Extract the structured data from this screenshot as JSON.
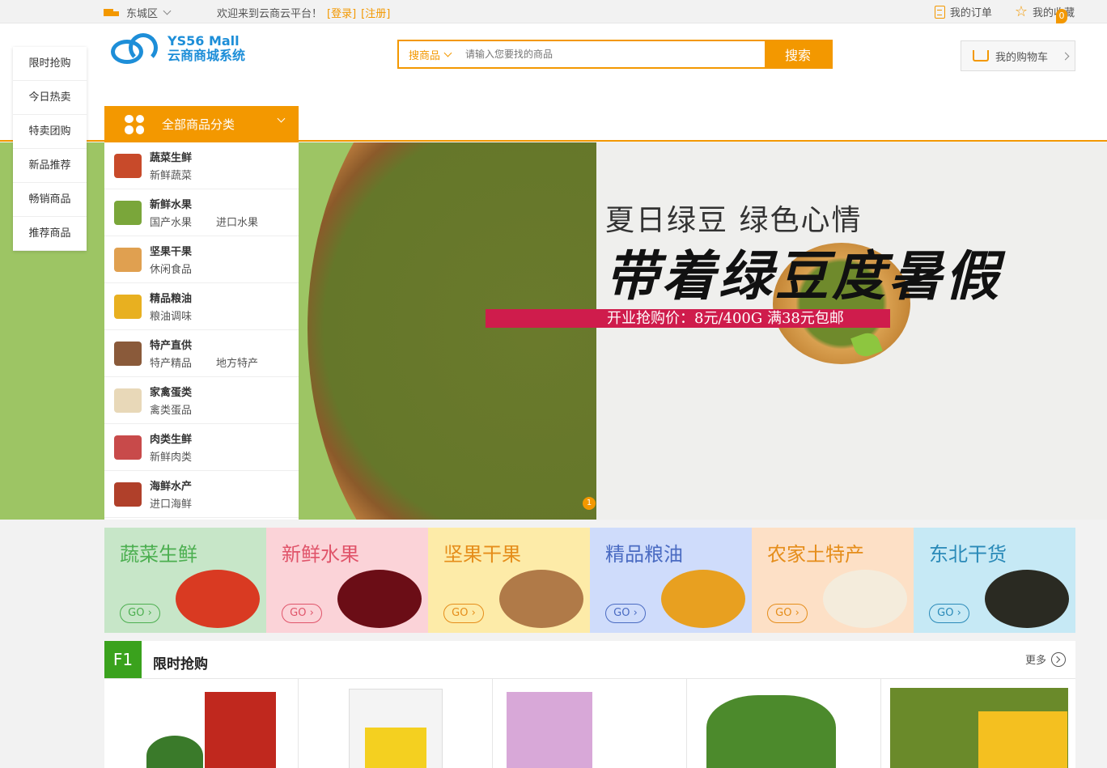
{
  "topbar": {
    "location": "东城区",
    "welcome": "欢迎来到云商云平台！",
    "login": "[登录]",
    "register": "[注册]",
    "my_orders": "我的订单",
    "my_favorites": "我的收藏"
  },
  "header": {
    "logo_en": "YS56 Mall",
    "logo_cn": "云商商城系统",
    "search_scope": "搜商品",
    "search_placeholder": "请输入您要找的商品",
    "search_button": "搜索",
    "cart_label": "我的购物车",
    "cart_count": "0"
  },
  "float_menu": [
    "限时抢购",
    "今日热卖",
    "特卖团购",
    "新品推荐",
    "畅销商品",
    "推荐商品"
  ],
  "all_categories": "全部商品分类",
  "categories": [
    {
      "name": "蔬菜生鲜",
      "subs": [
        "新鲜蔬菜"
      ],
      "color": "#c84a2a"
    },
    {
      "name": "新鲜水果",
      "subs": [
        "国产水果",
        "进口水果"
      ],
      "color": "#7aa63a"
    },
    {
      "name": "坚果干果",
      "subs": [
        "休闲食品"
      ],
      "color": "#e0a050"
    },
    {
      "name": "精品粮油",
      "subs": [
        "粮油调味"
      ],
      "color": "#e8b020"
    },
    {
      "name": "特产直供",
      "subs": [
        "特产精品",
        "地方特产"
      ],
      "color": "#8a5a3a"
    },
    {
      "name": "家禽蛋类",
      "subs": [
        "禽类蛋品"
      ],
      "color": "#e8d8b8"
    },
    {
      "name": "肉类生鲜",
      "subs": [
        "新鲜肉类"
      ],
      "color": "#c84a4a"
    },
    {
      "name": "海鲜水产",
      "subs": [
        "进口海鲜"
      ],
      "color": "#b0402a"
    }
  ],
  "banner": {
    "line1": "夏日绿豆 绿色心情",
    "line2": "带着绿豆度暑假",
    "promo": "开业抢购价：8元/400G   满38元包邮",
    "page": "1"
  },
  "tiles": [
    {
      "name": "蔬菜生鲜",
      "go": "GO ›",
      "bg": "#c7e6c8",
      "fg": "#4caf50",
      "pic": "#d93a22"
    },
    {
      "name": "新鲜水果",
      "go": "GO ›",
      "bg": "#fbd3d8",
      "fg": "#e0546a",
      "pic": "#6b0d16"
    },
    {
      "name": "坚果干果",
      "go": "GO ›",
      "bg": "#fdeba8",
      "fg": "#e58d1a",
      "pic": "#b07a48"
    },
    {
      "name": "精品粮油",
      "go": "GO ›",
      "bg": "#cfdcfb",
      "fg": "#4a6bc2",
      "pic": "#e8a020"
    },
    {
      "name": "农家土特产",
      "go": "GO ›",
      "bg": "#fde0c6",
      "fg": "#e58d1a",
      "pic": "#f4ecdc"
    },
    {
      "name": "东北干货",
      "go": "GO ›",
      "bg": "#c6e9f5",
      "fg": "#2a8ab8",
      "pic": "#2a2a22"
    }
  ],
  "section": {
    "tag": "F1",
    "title": "限时抢购",
    "more": "更多"
  }
}
